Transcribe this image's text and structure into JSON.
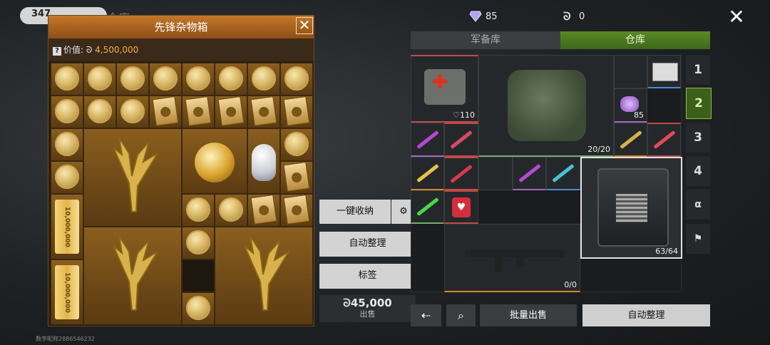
{
  "background": {
    "pill_text": "347",
    "title": "仓库"
  },
  "crate": {
    "title": "先锋杂物箱",
    "close": "✕",
    "value_label": "价值:",
    "currency_symbol": "ᘐ",
    "value": "4,500,000",
    "bar_labels": [
      "10,000,000",
      "10,000,000"
    ]
  },
  "middle": {
    "quick_store": "一键收纳",
    "auto_sort": "自动整理",
    "tag": "标签",
    "sell_price": "ᘐ45,000",
    "sell_label": "出售"
  },
  "currencies": {
    "diamonds": "85",
    "coins": "0"
  },
  "tabs": {
    "armory": "军备库",
    "warehouse": "仓库"
  },
  "inventory": {
    "medkit_count": "♡110",
    "vest_count": "20/20",
    "gems_count": "85",
    "box_count": "63/64",
    "rifle_count": "0/0"
  },
  "side_tabs": [
    "1",
    "2",
    "3",
    "4"
  ],
  "bottom": {
    "back": "⇠",
    "search": "⌕",
    "batch_sell": "批量出售",
    "auto_sort": "自动整理"
  },
  "footer": {
    "uid": "数字昵称2886546232"
  },
  "colors": {
    "warehouse_tab": "#4a7a1f",
    "crate_header": "#b56a22",
    "accent_gold": "#f0b040"
  }
}
